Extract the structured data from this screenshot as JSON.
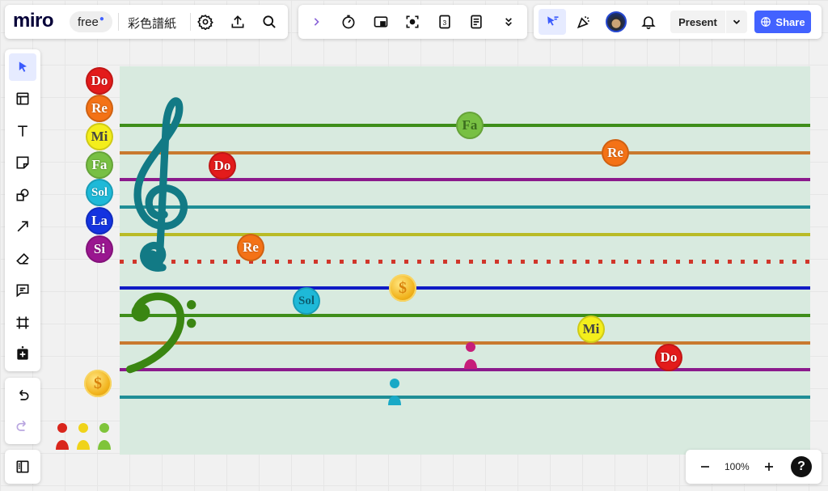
{
  "brand": {
    "logo": "miro",
    "plan_badge": "free"
  },
  "board": {
    "title": "彩色譜紙"
  },
  "top_toolbar": {
    "left_icons": [
      "gear-icon",
      "upload-icon",
      "search-icon"
    ],
    "mid_icons": [
      "chevron-right-icon",
      "timer-icon",
      "video-screen-icon",
      "focus-icon",
      "sequence-card-icon",
      "notes-icon",
      "more-down-icon"
    ],
    "right_icons": [
      "cursor-select-icon",
      "confetti-icon",
      "avatar",
      "bell-icon"
    ]
  },
  "present": {
    "label": "Present"
  },
  "share": {
    "label": "Share"
  },
  "left_toolbar": [
    "select-icon",
    "templates-icon",
    "text-icon",
    "sticky-note-icon",
    "shapes-icon",
    "arrow-icon",
    "eraser-icon",
    "comment-icon",
    "frame-icon",
    "add-more-icon"
  ],
  "history": [
    "undo-icon",
    "redo-icon"
  ],
  "zoom": {
    "level": "100%"
  },
  "legend_notes": [
    {
      "label": "Do",
      "color": "#e31b1b"
    },
    {
      "label": "Re",
      "color": "#f47216"
    },
    {
      "label": "Mi",
      "color": "#f4ee1c"
    },
    {
      "label": "Fa",
      "color": "#78c043"
    },
    {
      "label": "Sol",
      "color": "#1eb9d8"
    },
    {
      "label": "La",
      "color": "#1433e0"
    },
    {
      "label": "Si",
      "color": "#9a1690"
    }
  ],
  "staff_notes": [
    "Fa",
    "Re",
    "Do",
    "Re",
    "Sol",
    "Mi",
    "Do"
  ],
  "staff_colors": {
    "green": "#3e8e1a",
    "orange": "#c9792e",
    "purple": "#8b1a8c",
    "teal": "#1f8e96",
    "yellow": "#b9bb26",
    "blue": "#0f1bc5",
    "red_dotted": "#d0362a"
  },
  "coin_symbol": "$"
}
